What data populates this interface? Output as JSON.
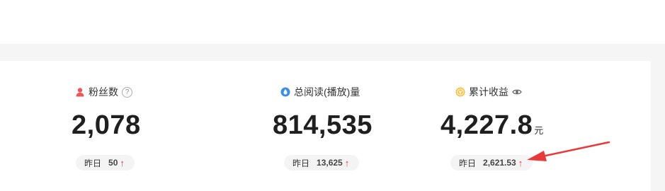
{
  "stats": [
    {
      "label": "粉丝数",
      "value": "2,078",
      "unit": "",
      "yesterday_label": "昨日",
      "yesterday_value": "50",
      "icon": "user-icon",
      "color": "#e8575a"
    },
    {
      "label": "总阅读(播放)量",
      "value": "814,535",
      "unit": "",
      "yesterday_label": "昨日",
      "yesterday_value": "13,625",
      "icon": "drop-icon",
      "color": "#3d8fe0"
    },
    {
      "label": "累计收益",
      "value": "4,227.8",
      "unit": "元",
      "yesterday_label": "昨日",
      "yesterday_value": "2,621.53",
      "icon": "coin-icon",
      "color": "#f3c042"
    }
  ],
  "trend_arrow": "↑",
  "help_glyph": "?"
}
